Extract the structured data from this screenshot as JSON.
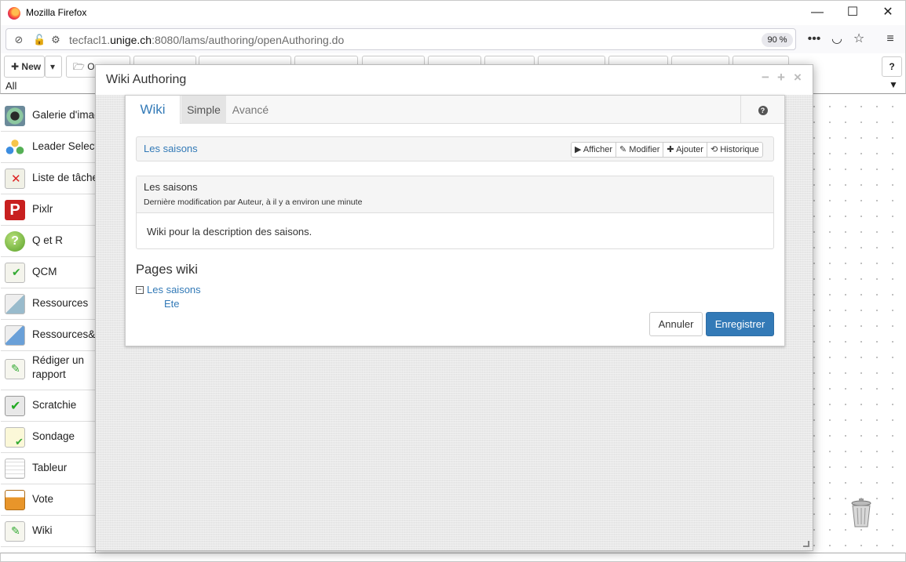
{
  "browser": {
    "window_title": "Mozilla Firefox",
    "url_prefix": "tecfacl1.",
    "url_domain": "unige.ch",
    "url_suffix": ":8080/lams/authoring/openAuthoring.do",
    "zoom": "90 %"
  },
  "toolbar": {
    "new_label": "New",
    "open_label": "Op",
    "help_label": "?"
  },
  "filter": {
    "value": "All"
  },
  "sidebar": {
    "items": [
      {
        "label": "Galerie d'imag"
      },
      {
        "label": "Leader Select"
      },
      {
        "label": "Liste de tâche"
      },
      {
        "label": "Pixlr"
      },
      {
        "label": "Q et R"
      },
      {
        "label": "QCM"
      },
      {
        "label": "Ressources"
      },
      {
        "label": "Ressources&"
      },
      {
        "label": "Rédiger un rapport"
      },
      {
        "label": "Scratchie"
      },
      {
        "label": "Sondage"
      },
      {
        "label": "Tableur"
      },
      {
        "label": "Vote"
      },
      {
        "label": "Wiki"
      }
    ]
  },
  "dialog": {
    "title": "Wiki Authoring",
    "tabs": {
      "wiki": "Wiki",
      "simple": "Simple",
      "avance": "Avancé",
      "help": "?"
    },
    "nav": {
      "current_page": "Les saisons",
      "buttons": [
        "▶ Afficher",
        "✎ Modifier",
        "✚ Ajouter",
        "⟲ Historique"
      ]
    },
    "page": {
      "title": "Les saisons",
      "meta": "Dernière modification par Auteur, à il y a environ une minute",
      "body": "Wiki pour la description des saisons."
    },
    "pages_heading": "Pages wiki",
    "tree": {
      "toggle": "−",
      "root": "Les saisons",
      "child": "Ete"
    },
    "cancel_label": "Annuler",
    "save_label": "Enregistrer"
  },
  "colors": {
    "link": "#337ab7",
    "primary_button": "#337ab7"
  }
}
